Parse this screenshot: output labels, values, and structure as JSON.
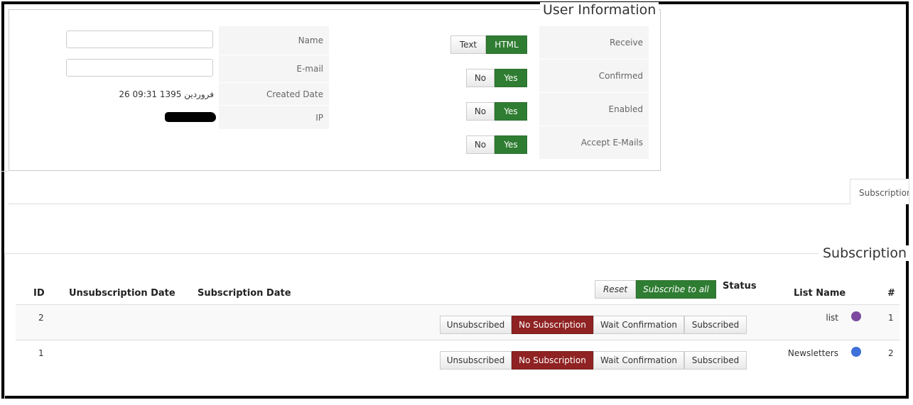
{
  "user_info": {
    "legend": "User Information",
    "fields": {
      "name_label": "Name",
      "email_label": "E-mail",
      "created_label": "Created Date",
      "created_value": "26 فروردین 1395 09:31",
      "ip_label": "IP"
    },
    "options": {
      "receive_label": "Receive",
      "receive_text": "Text",
      "receive_html": "HTML",
      "confirmed_label": "Confirmed",
      "enabled_label": "Enabled",
      "accept_label": "Accept E-Mails",
      "no": "No",
      "yes": "Yes"
    }
  },
  "tabs": {
    "subscription": "Subscription"
  },
  "subscription": {
    "legend": "Subscription",
    "headers": {
      "id": "ID",
      "unsub_date": "Unsubscription Date",
      "sub_date": "Subscription Date",
      "status": "Status",
      "list_name": "List Name",
      "num": "#"
    },
    "reset": "Reset",
    "subscribe_all": "Subscribe to all",
    "status_buttons": {
      "unsubscribed": "Unsubscribed",
      "no_subscription": "No Subscription",
      "wait_confirmation": "Wait Confirmation",
      "subscribed": "Subscribed"
    },
    "rows": [
      {
        "id": "2",
        "list_name": "list",
        "num": "1",
        "color": "#7b4a9e"
      },
      {
        "id": "1",
        "list_name": "Newsletters",
        "num": "2",
        "color": "#3f6fd8"
      }
    ]
  },
  "colors": {
    "green": "#2f7d32",
    "red": "#8f2222"
  }
}
